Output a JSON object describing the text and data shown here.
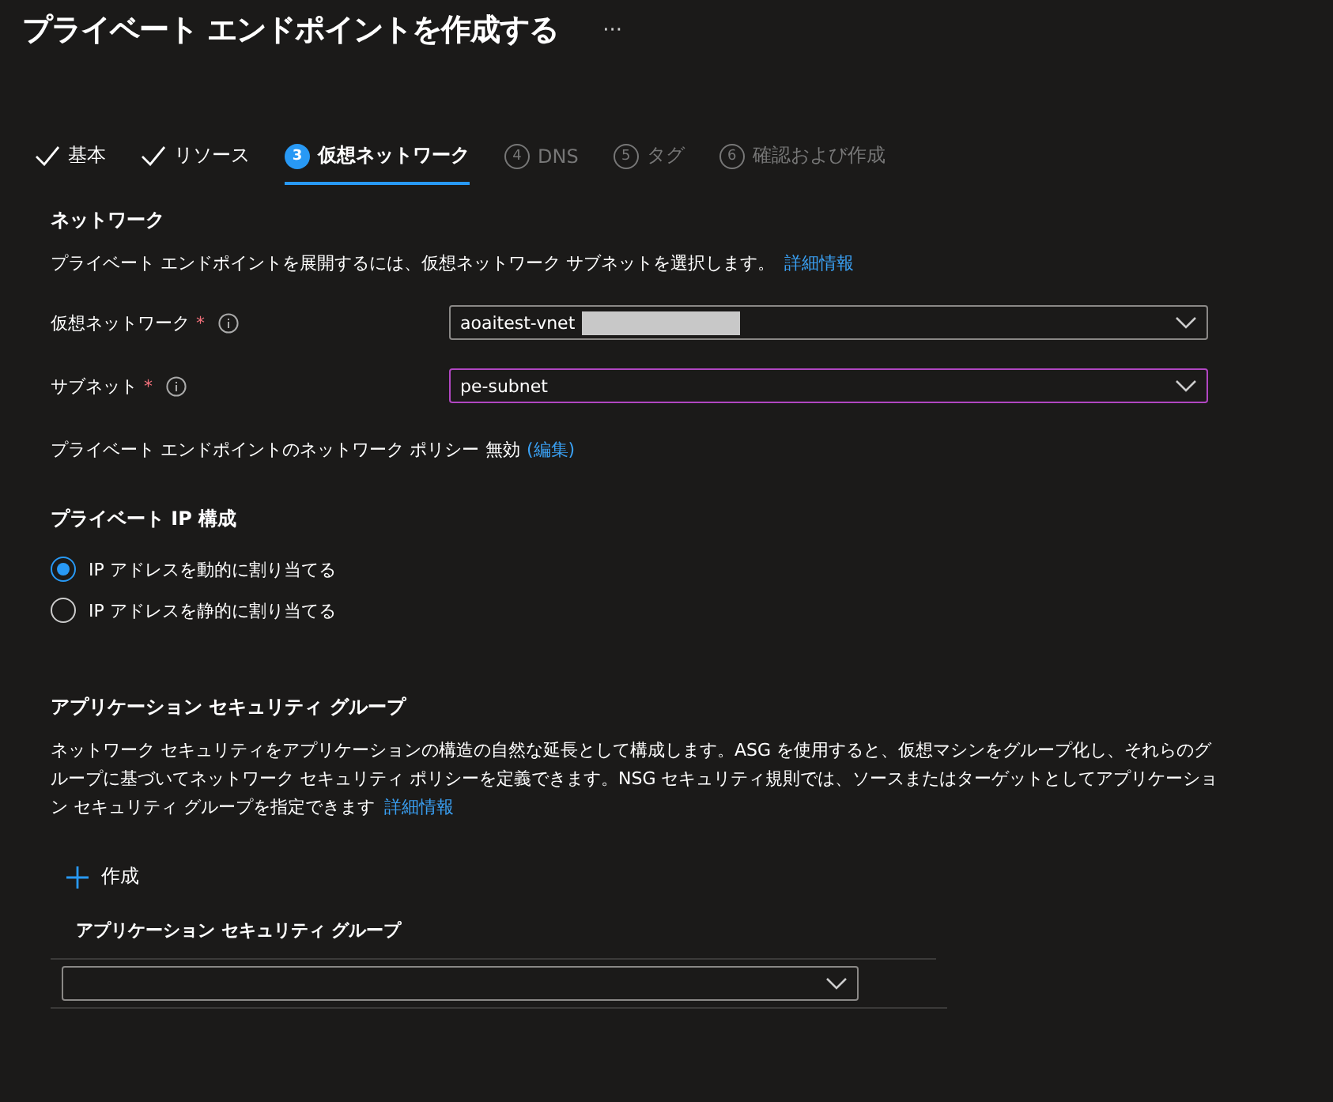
{
  "title": "プライベート エンドポイントを作成する",
  "more": "···",
  "tabs": [
    {
      "label": "基本",
      "kind": "done",
      "selected": false
    },
    {
      "label": "リソース",
      "kind": "done",
      "selected": false
    },
    {
      "label": "仮想ネットワーク",
      "kind": "current",
      "number": "3",
      "selected": true
    },
    {
      "label": "DNS",
      "kind": "pending",
      "number": "4",
      "selected": false
    },
    {
      "label": "タグ",
      "kind": "pending",
      "number": "5",
      "selected": false
    },
    {
      "label": "確認および作成",
      "kind": "pending",
      "number": "6",
      "selected": false
    }
  ],
  "network": {
    "heading": "ネットワーク",
    "description": "プライベート エンドポイントを展開するには、仮想ネットワーク サブネットを選択します。",
    "link": "詳細情報",
    "fields": [
      {
        "label": "仮想ネットワーク",
        "required_mark": "*",
        "value": "aoaitest-vnet",
        "redacted": true,
        "focused": false
      },
      {
        "label": "サブネット",
        "required_mark": "*",
        "value": "pe-subnet",
        "redacted": false,
        "focused": true
      }
    ],
    "policy": {
      "label": "プライベート エンドポイントのネットワーク ポリシー",
      "value": "無効",
      "link": "(編集)"
    }
  },
  "private_ip": {
    "heading": "プライベート IP 構成",
    "options": [
      {
        "label": "IP アドレスを動的に割り当てる",
        "selected": true
      },
      {
        "label": "IP アドレスを静的に割り当てる",
        "selected": false
      }
    ]
  },
  "asg": {
    "heading": "アプリケーション セキュリティ グループ",
    "description": "ネットワーク セキュリティをアプリケーションの構造の自然な延長として構成します。ASG を使用すると、仮想マシンをグループ化し、それらのグループに基づいてネットワーク セキュリティ ポリシーを定義できます。NSG セキュリティ規則では、ソースまたはターゲットとしてアプリケーション セキュリティ グループを指定できます",
    "link": "詳細情報",
    "create": "作成",
    "column": "アプリケーション セキュリティ グループ"
  }
}
